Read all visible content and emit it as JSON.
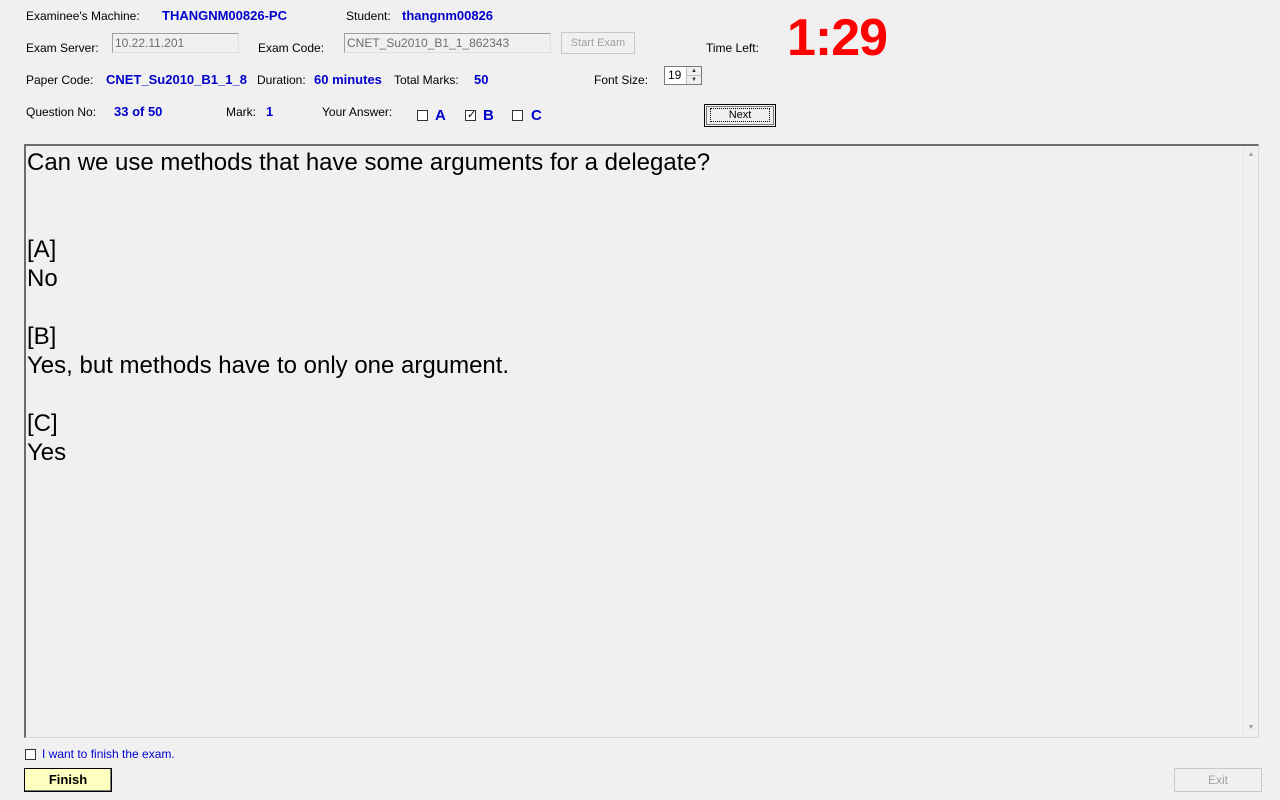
{
  "header": {
    "machine_label": "Examinee's Machine:",
    "machine_value": "THANGNM00826-PC",
    "student_label": "Student:",
    "student_value": "thangnm00826",
    "server_label": "Exam Server:",
    "server_value": "10.22.11.201",
    "exam_code_label": "Exam Code:",
    "exam_code_value": "CNET_Su2010_B1_1_862343",
    "start_exam_label": "Start Exam",
    "time_left_label": "Time Left:",
    "time_left_value": "1:29",
    "paper_code_label": "Paper Code:",
    "paper_code_value": "CNET_Su2010_B1_1_8",
    "duration_label": "Duration:",
    "duration_value": "60 minutes",
    "total_marks_label": "Total Marks:",
    "total_marks_value": "50",
    "font_size_label": "Font Size:",
    "font_size_value": "19",
    "question_no_label": "Question No:",
    "question_no_value": "33 of 50",
    "mark_label": "Mark:",
    "mark_value": "1",
    "your_answer_label": "Your Answer:",
    "options": [
      {
        "letter": "A",
        "checked": false
      },
      {
        "letter": "B",
        "checked": true
      },
      {
        "letter": "C",
        "checked": false
      }
    ],
    "next_label": "Next"
  },
  "question": {
    "text": "Can we use methods that have some arguments for a delegate?\n\n\n[A]\nNo\n\n[B]\nYes, but methods have to only one argument.\n\n[C]\nYes"
  },
  "footer": {
    "finish_checkbox_label": "I want to finish the exam.",
    "finish_button_label": "Finish",
    "exit_button_label": "Exit"
  },
  "colors": {
    "value_blue": "#0000cc",
    "timer_red": "#ff0000",
    "finish_yellow": "#ffffc0",
    "background": "#f0f0f0"
  }
}
